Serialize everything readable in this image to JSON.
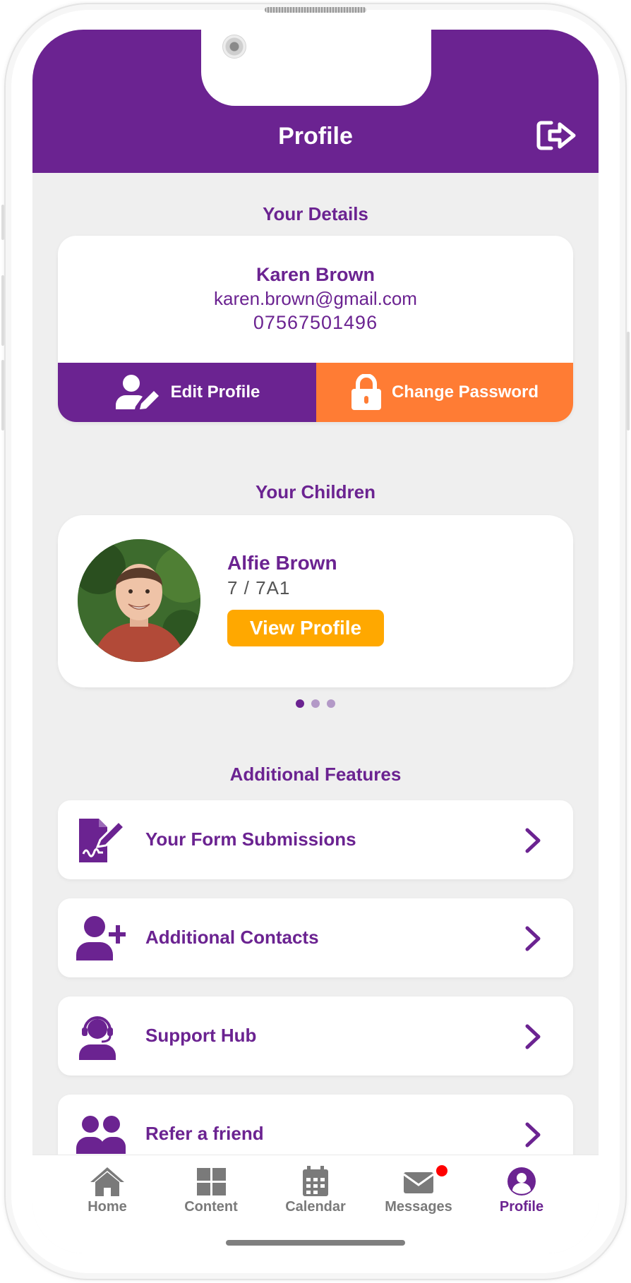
{
  "header": {
    "title": "Profile",
    "logout_icon": "logout-icon"
  },
  "details": {
    "section_title": "Your Details",
    "name": "Karen Brown",
    "email": "karen.brown@gmail.com",
    "phone": "07567501496",
    "edit_label": "Edit Profile",
    "password_label": "Change Password"
  },
  "children": {
    "section_title": "Your Children",
    "items": [
      {
        "name": "Alfie Brown",
        "class": "7 / 7A1",
        "button_label": "View Profile"
      }
    ],
    "pager": {
      "count": 3,
      "active": 1
    }
  },
  "features": {
    "section_title": "Additional Features",
    "items": [
      {
        "label": "Your Form Submissions",
        "icon": "form-signature-icon"
      },
      {
        "label": "Additional Contacts",
        "icon": "user-plus-icon"
      },
      {
        "label": "Support Hub",
        "icon": "headset-icon"
      },
      {
        "label": "Refer a friend",
        "icon": "users-icon"
      }
    ]
  },
  "tabbar": {
    "items": [
      {
        "label": "Home",
        "icon": "home-icon"
      },
      {
        "label": "Content",
        "icon": "grid-icon"
      },
      {
        "label": "Calendar",
        "icon": "calendar-icon"
      },
      {
        "label": "Messages",
        "icon": "envelope-icon"
      },
      {
        "label": "Profile",
        "icon": "profile-icon"
      }
    ],
    "active": "Profile"
  },
  "colors": {
    "brand": "#6b2391",
    "accent": "#ff7c34",
    "view_button": "#ffa800",
    "badge": "#ff0000"
  }
}
